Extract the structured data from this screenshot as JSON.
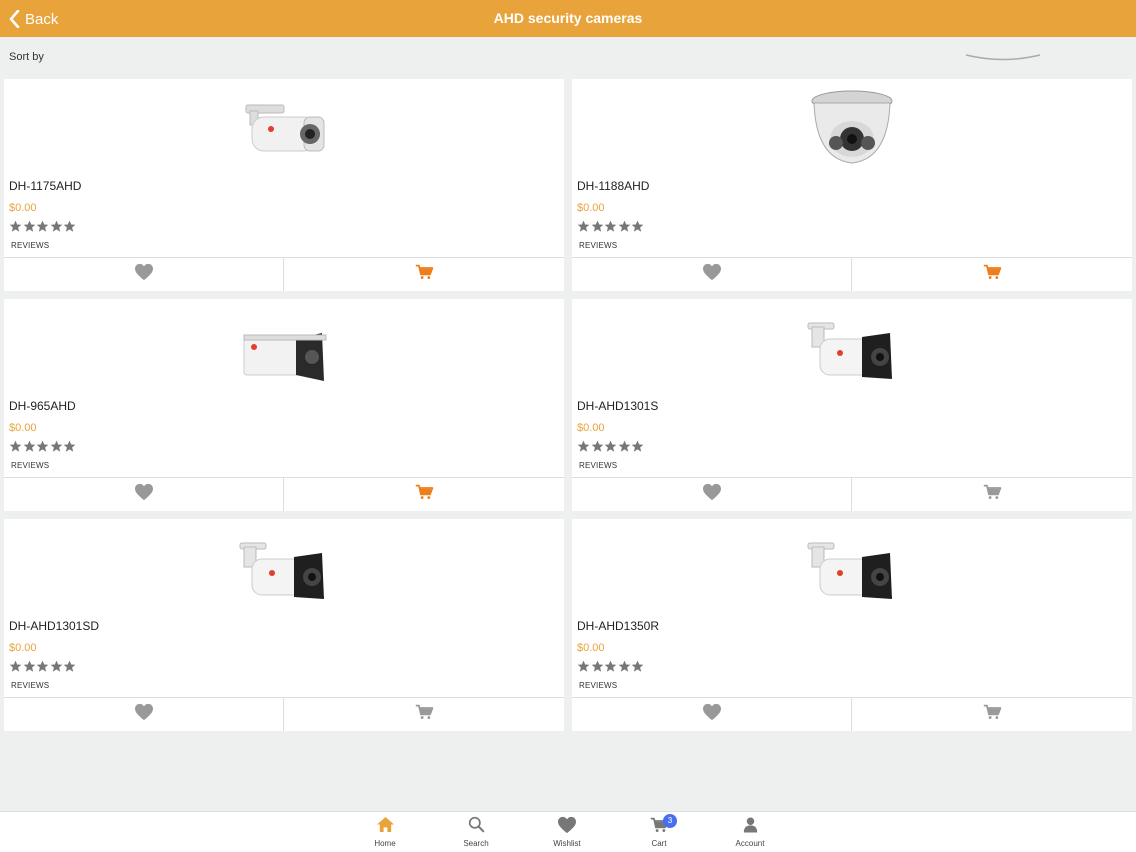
{
  "header": {
    "back_label": "Back",
    "title": "AHD security cameras"
  },
  "sort": {
    "label": "Sort by"
  },
  "products": [
    {
      "name": "DH-1175AHD",
      "price": "$0.00",
      "reviews_label": "REVIEWS",
      "rating": 5,
      "cart_active": true,
      "image": "bullet-camera"
    },
    {
      "name": "DH-1188AHD",
      "price": "$0.00",
      "reviews_label": "REVIEWS",
      "rating": 5,
      "cart_active": true,
      "image": "dome-camera"
    },
    {
      "name": "DH-965AHD",
      "price": "$0.00",
      "reviews_label": "REVIEWS",
      "rating": 5,
      "cart_active": true,
      "image": "box-bullet-camera"
    },
    {
      "name": "DH-AHD1301S",
      "price": "$0.00",
      "reviews_label": "REVIEWS",
      "rating": 5,
      "cart_active": false,
      "image": "bullet-camera-black-front"
    },
    {
      "name": "DH-AHD1301SD",
      "price": "$0.00",
      "reviews_label": "REVIEWS",
      "rating": 5,
      "cart_active": false,
      "image": "bullet-camera-black-front"
    },
    {
      "name": "DH-AHD1350R",
      "price": "$0.00",
      "reviews_label": "REVIEWS",
      "rating": 5,
      "cart_active": false,
      "image": "bullet-camera-black-front"
    }
  ],
  "tabs": [
    {
      "label": "Home",
      "icon": "home-icon",
      "active": true
    },
    {
      "label": "Search",
      "icon": "search-icon",
      "active": false
    },
    {
      "label": "Wishlist",
      "icon": "heart-icon",
      "active": false
    },
    {
      "label": "Cart",
      "icon": "cart-icon",
      "active": false,
      "badge": "3"
    },
    {
      "label": "Account",
      "icon": "account-icon",
      "active": false
    }
  ],
  "colors": {
    "accent": "#e8a33a",
    "cart_active": "#ef7d1a",
    "icon_gray": "#999999",
    "star": "#777777",
    "badge": "#4a6ef0"
  }
}
